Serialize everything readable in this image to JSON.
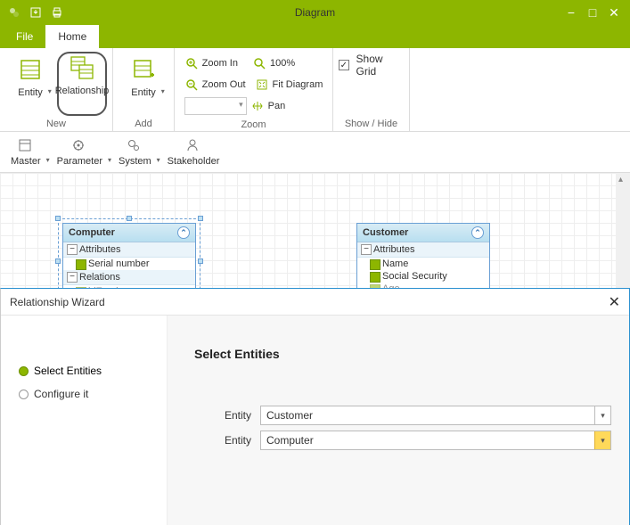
{
  "titlebar": {
    "title": "Diagram"
  },
  "tabs": {
    "file": "File",
    "home": "Home"
  },
  "ribbon": {
    "new": {
      "label": "New",
      "entity": "Entity",
      "relationship": "Relationship"
    },
    "add": {
      "label": "Add",
      "entity": "Entity"
    },
    "zoom": {
      "label": "Zoom",
      "zoom_in": "Zoom In",
      "zoom_out": "Zoom Out",
      "percent_100": "100%",
      "fit_diagram": "Fit Diagram",
      "pan": "Pan"
    },
    "show_hide": {
      "label": "Show / Hide",
      "show_grid": "Show Grid"
    }
  },
  "toolbar2": {
    "master": "Master",
    "parameter": "Parameter",
    "system": "System",
    "stakeholder": "Stakeholder"
  },
  "entities": {
    "computer": {
      "title": "Computer",
      "attributes_label": "Attributes",
      "attributes": [
        "Serial number"
      ],
      "relations_label": "Relations",
      "relations": [
        "idEmployee"
      ]
    },
    "customer": {
      "title": "Customer",
      "attributes_label": "Attributes",
      "attributes": [
        "Name",
        "Social Security",
        "Age"
      ]
    }
  },
  "wizard": {
    "title": "Relationship Wizard",
    "steps": {
      "select_entities": "Select Entities",
      "configure": "Configure it"
    },
    "content": {
      "heading": "Select Entities",
      "entity_label": "Entity",
      "value1": "Customer",
      "value2": "Computer"
    }
  }
}
